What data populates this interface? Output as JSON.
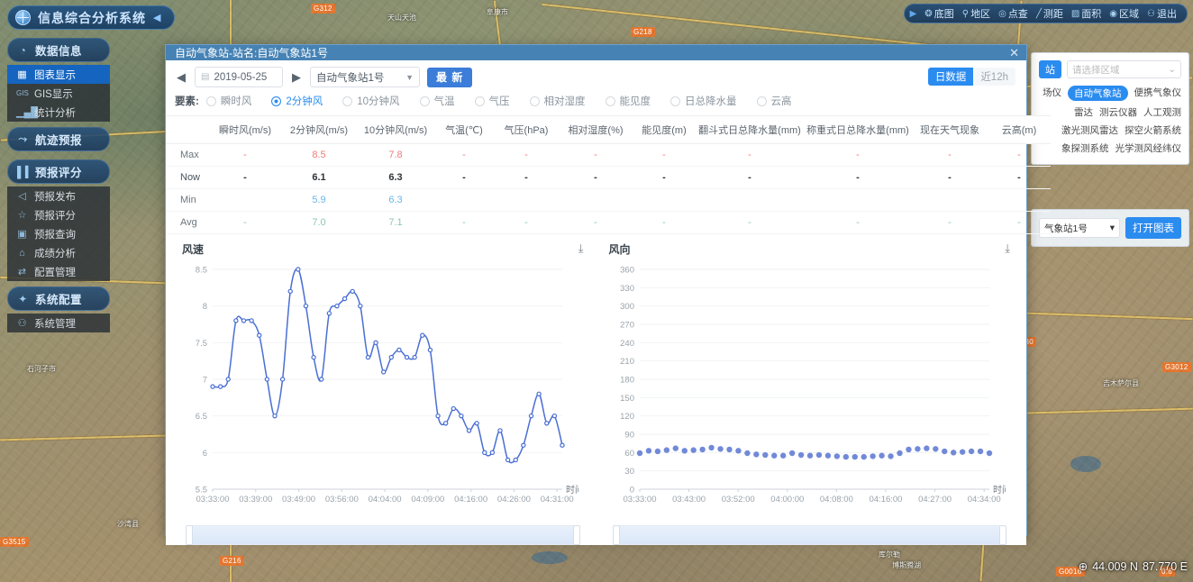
{
  "brand": {
    "title": "信息综合分析系统",
    "collapse_icon": "◀",
    "logo_icon": "globe-icon"
  },
  "sidebar": {
    "groups": [
      {
        "label": "数据信息",
        "icon": "pie-chart-icon",
        "items": [
          {
            "label": "图表显示",
            "icon": "table-icon",
            "active": true
          },
          {
            "label": "GIS显示",
            "icon": "gis-icon",
            "active": false
          },
          {
            "label": "统计分析",
            "icon": "bar-chart-icon",
            "active": false
          }
        ]
      },
      {
        "label": "航迹预报",
        "icon": "route-icon",
        "items": []
      },
      {
        "label": "预报评分",
        "icon": "chart-icon",
        "items": [
          {
            "label": "预报发布",
            "icon": "send-icon",
            "active": false
          },
          {
            "label": "预报评分",
            "icon": "star-icon",
            "active": false
          },
          {
            "label": "预报查询",
            "icon": "search-doc-icon",
            "active": false
          },
          {
            "label": "成绩分析",
            "icon": "analysis-icon",
            "active": false
          },
          {
            "label": "配置管理",
            "icon": "slider-icon",
            "active": false
          }
        ]
      },
      {
        "label": "系统配置",
        "icon": "gear-icon",
        "items": [
          {
            "label": "系统管理",
            "icon": "user-icon",
            "active": false
          }
        ]
      }
    ]
  },
  "map_toolbar": {
    "arrow": "▶",
    "items": [
      {
        "label": "底图",
        "icon": "layers-icon"
      },
      {
        "label": "地区",
        "icon": "pin-icon"
      },
      {
        "label": "点查",
        "icon": "target-icon"
      },
      {
        "label": "测距",
        "icon": "ruler-icon"
      },
      {
        "label": "面积",
        "icon": "area-icon"
      },
      {
        "label": "区域",
        "icon": "circle-dot-icon"
      },
      {
        "label": "退出",
        "icon": "exit-icon"
      }
    ]
  },
  "right_panel": {
    "badge": "站",
    "region_placeholder": "请选择区域",
    "chips": [
      {
        "label": "场仪",
        "on": false
      },
      {
        "label": "自动气象站",
        "on": true
      },
      {
        "label": "便携气象仪",
        "on": false
      },
      {
        "label": "雷达",
        "on": false
      },
      {
        "label": "测云仪器",
        "on": false
      },
      {
        "label": "人工观测",
        "on": false
      },
      {
        "label": "激光测风雷达",
        "on": false
      },
      {
        "label": "探空火箭系统",
        "on": false
      },
      {
        "label": "象探测系统",
        "on": false
      },
      {
        "label": "光学测风经纬仪",
        "on": false
      }
    ]
  },
  "right_panel2": {
    "station_value": "气象站1号",
    "open_chart_label": "打开图表"
  },
  "coords": {
    "icon": "crosshair-icon",
    "lat": "44.009 N",
    "lon": "87.770 E"
  },
  "dialog": {
    "title": "自动气象站-站名:自动气象站1号",
    "close_icon": "✕",
    "prev_icon": "◀",
    "next_icon": "▶",
    "calendar_icon": "▤",
    "date": "2019-05-25",
    "station": "自动气象站1号",
    "latest_label": "最 新",
    "range_options": [
      {
        "label": "日数据",
        "on": true
      },
      {
        "label": "近12h",
        "on": false
      }
    ],
    "element_label": "要素:",
    "elements": [
      {
        "label": "瞬时风",
        "on": false
      },
      {
        "label": "2分钟风",
        "on": true
      },
      {
        "label": "10分钟风",
        "on": false
      },
      {
        "label": "气温",
        "on": false
      },
      {
        "label": "气压",
        "on": false
      },
      {
        "label": "相对湿度",
        "on": false
      },
      {
        "label": "能见度",
        "on": false
      },
      {
        "label": "日总降水量",
        "on": false
      },
      {
        "label": "云高",
        "on": false
      }
    ],
    "table": {
      "columns": [
        "",
        "瞬时风(m/s)",
        "2分钟风(m/s)",
        "10分钟风(m/s)",
        "气温(℃)",
        "气压(hPa)",
        "相对湿度(%)",
        "能见度(m)",
        "翻斗式日总降水量(mm)",
        "称重式日总降水量(mm)",
        "现在天气现象",
        "云高(m)"
      ],
      "rows": [
        {
          "label": "Max",
          "cells": [
            "-",
            "8.5",
            "7.8",
            "-",
            "-",
            "-",
            "-",
            "-",
            "-",
            "-",
            "-"
          ]
        },
        {
          "label": "Now",
          "cells": [
            "-",
            "6.1",
            "6.3",
            "-",
            "-",
            "-",
            "-",
            "-",
            "-",
            "-",
            "-"
          ]
        },
        {
          "label": "Min",
          "cells": [
            "",
            "5.9",
            "6.3",
            "",
            "",
            "",
            "",
            "",
            "",
            "",
            ""
          ]
        },
        {
          "label": "Avg",
          "cells": [
            "-",
            "7.0",
            "7.1",
            "-",
            "-",
            "-",
            "-",
            "-",
            "-",
            "-",
            "-"
          ]
        }
      ]
    },
    "download_icon": "⤓"
  },
  "chart_data": [
    {
      "type": "line",
      "title": "风速",
      "xlabel": "时间",
      "ylabel": "",
      "ylim": [
        5.5,
        8.5
      ],
      "yticks": [
        5.5,
        6,
        6.5,
        7,
        7.5,
        8,
        8.5
      ],
      "xticks": [
        "03:33:00",
        "03:39:00",
        "03:49:00",
        "03:56:00",
        "04:04:00",
        "04:09:00",
        "04:16:00",
        "04:26:00",
        "04:31:00"
      ],
      "grid": true,
      "legend": "none",
      "values": [
        6.9,
        6.9,
        7.0,
        7.8,
        7.8,
        7.8,
        7.6,
        7.0,
        6.5,
        7.0,
        8.2,
        8.5,
        8.0,
        7.3,
        7.0,
        7.9,
        8.0,
        8.1,
        8.2,
        8.0,
        7.3,
        7.5,
        7.1,
        7.3,
        7.4,
        7.3,
        7.3,
        7.6,
        7.4,
        6.5,
        6.4,
        6.6,
        6.5,
        6.3,
        6.4,
        6.0,
        6.0,
        6.3,
        5.9,
        5.9,
        6.1,
        6.5,
        6.8,
        6.4,
        6.5,
        6.1
      ]
    },
    {
      "type": "scatter",
      "title": "风向",
      "xlabel": "时间",
      "ylabel": "",
      "ylim": [
        0,
        360
      ],
      "yticks": [
        0,
        30,
        60,
        90,
        120,
        150,
        180,
        210,
        240,
        270,
        300,
        330,
        360
      ],
      "xticks": [
        "03:33:00",
        "03:43:00",
        "03:52:00",
        "04:00:00",
        "04:08:00",
        "04:16:00",
        "04:27:00",
        "04:34:00"
      ],
      "grid": true,
      "legend": "none",
      "values": [
        59,
        63,
        62,
        64,
        67,
        63,
        64,
        65,
        68,
        66,
        65,
        63,
        59,
        57,
        56,
        55,
        55,
        59,
        56,
        55,
        56,
        55,
        54,
        53,
        53,
        53,
        54,
        55,
        54,
        59,
        65,
        66,
        67,
        66,
        62,
        60,
        61,
        62,
        62,
        59
      ]
    }
  ]
}
